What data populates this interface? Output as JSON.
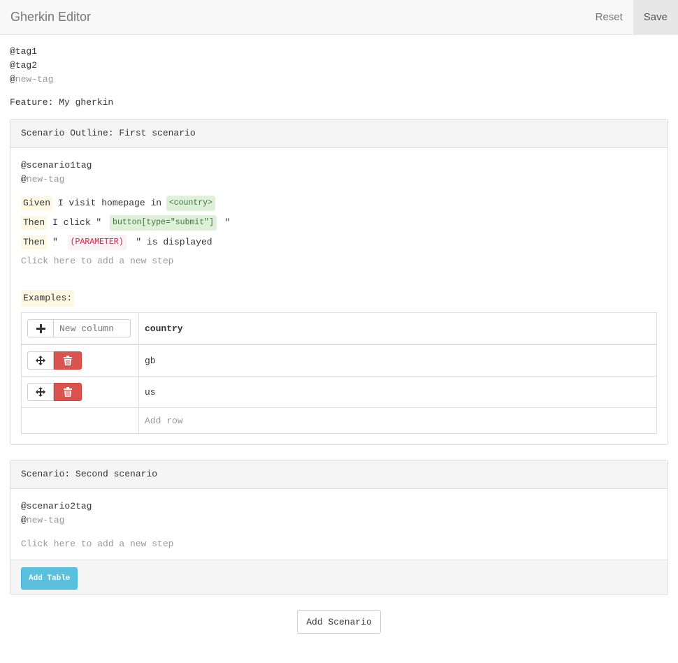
{
  "app": {
    "title": "Gherkin Editor",
    "reset_label": "Reset",
    "save_label": "Save"
  },
  "feature": {
    "tags": [
      "@tag1",
      "@tag2"
    ],
    "new_tag_prefix": "@",
    "new_tag_placeholder": "new-tag",
    "line": "Feature: My gherkin"
  },
  "scenario1": {
    "heading": "Scenario Outline: First scenario",
    "tag": "@scenario1tag",
    "new_tag_prefix": "@",
    "new_tag_placeholder": "new-tag",
    "steps": [
      {
        "keyword": "Given",
        "before": " I visit homepage in ",
        "param": "<country>",
        "after": ""
      },
      {
        "keyword": "Then",
        "before": " I click \" ",
        "param": "button[type=\"submit\"]",
        "after": " \""
      },
      {
        "keyword": "Then",
        "before": " \" ",
        "param": "(PARAMETER)",
        "after": " \" is displayed"
      }
    ],
    "add_step": "Click here to add a new step",
    "examples_label": "Examples:",
    "new_column_placeholder": "New column",
    "column_header": "country",
    "rows": [
      "gb",
      "us"
    ],
    "add_row": "Add row"
  },
  "scenario2": {
    "heading": "Scenario: Second scenario",
    "tag": "@scenario2tag",
    "new_tag_prefix": "@",
    "new_tag_placeholder": "new-tag",
    "add_step": "Click here to add a new step",
    "add_table_label": "Add Table"
  },
  "add_scenario_label": "Add Scenario",
  "colors": {
    "keyword_bg": "#fcf8e3",
    "param_green_bg": "#dff0d8",
    "param_red_text": "#c7254e",
    "danger": "#d9534f",
    "info": "#5bc0de"
  },
  "icons": [
    "plus-icon",
    "move-icon",
    "trash-icon"
  ]
}
